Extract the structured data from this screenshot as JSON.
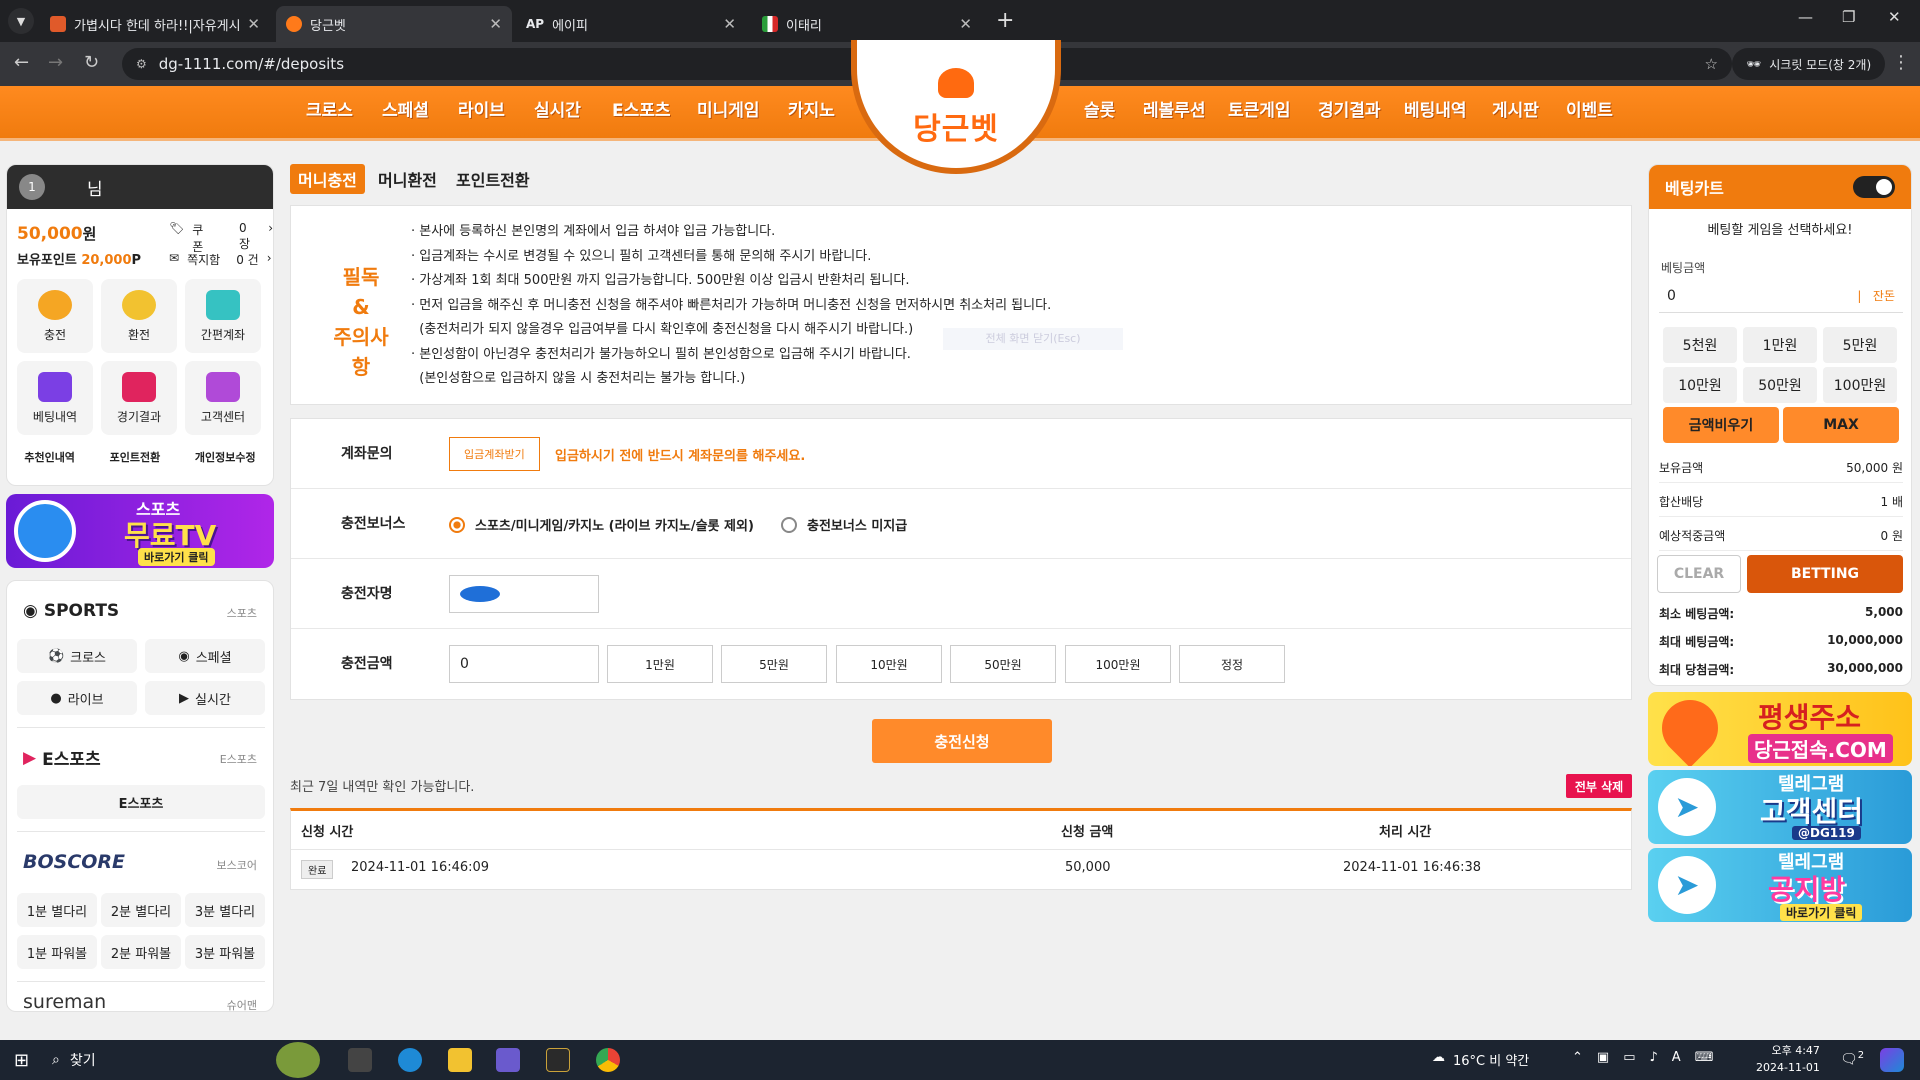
{
  "browser": {
    "tabs": [
      {
        "title": "가볍시다 한데 하라!!|자유게시판",
        "active": false
      },
      {
        "title": "당근벳",
        "active": true
      },
      {
        "title": "에이피",
        "prefix": "AP",
        "active": false
      },
      {
        "title": "이태리",
        "active": false
      }
    ],
    "url": "dg-1111.com/#/deposits",
    "incognito_label": "시크릿 모드(창 2개)"
  },
  "nav": {
    "left": [
      "크로스",
      "스페셜",
      "라이브",
      "실시간",
      "E스포츠",
      "미니게임",
      "카지노"
    ],
    "right": [
      "슬롯",
      "레볼루션",
      "토큰게임",
      "경기결과",
      "베팅내역",
      "게시판",
      "이벤트"
    ],
    "logo": "당근벳"
  },
  "user": {
    "level": "1",
    "name": "님",
    "balance": "50,000",
    "balance_unit": "원",
    "points_label": "보유포인트",
    "points": "20,000",
    "points_unit": "P",
    "coupon_label": "쿠폰",
    "coupon_count": "0 장",
    "note_label": "쪽지함",
    "note_count": "0 건",
    "quick": [
      "충전",
      "환전",
      "간편계좌",
      "베팅내역",
      "경기결과",
      "고객센터"
    ],
    "links": [
      "추천인내역",
      "포인트전환",
      "개인정보수정"
    ]
  },
  "promo_tv": {
    "line1": "스포츠",
    "line2": "무료TV",
    "line3": "바로가기 클릭"
  },
  "sports": {
    "title": "SPORTS",
    "sub": "스포츠",
    "items": [
      "크로스",
      "스페셜",
      "라이브",
      "실시간"
    ],
    "esports_title": "E스포츠",
    "esports_sub": "E스포츠",
    "esports_item": "E스포츠",
    "boscore_title": "BOSCORE",
    "boscore_sub": "보스코어",
    "boscore_items": [
      "1분 별다리",
      "2분 별다리",
      "3분 별다리",
      "1분 파워볼",
      "2분 파워볼",
      "3분 파워볼"
    ],
    "sureman_title": "sureman",
    "sureman_sub": "슈어맨"
  },
  "main": {
    "tabs": [
      "머니충전",
      "머니환전",
      "포인트전환"
    ],
    "notice_title": [
      "필독",
      "&",
      "주의사항"
    ],
    "notice_lines": [
      "· 본사에 등록하신 본인명의 계좌에서 입금 하셔야 입금 가능합니다.",
      "· 입금계좌는 수시로 변경될 수 있으니 필히 고객센터를 통해 문의해 주시기 바랍니다.",
      "· 가상계좌 1회 최대 500만원 까지 입금가능합니다. 500만원 이상 입금시 반환처리 됩니다.",
      "· 먼저 입금을 해주신 후 머니충전 신청을 해주셔야 빠른처리가 가능하며 머니충전 신청을 먼저하시면 취소처리 됩니다.",
      "  (충전처리가 되지 않을경우 입금여부를 다시 확인후에 충전신청을 다시 해주시기 바랍니다.)",
      "· 본인성함이 아닌경우 충전처리가 불가능하오니 필히 본인성함으로 입금해 주시기 바랍니다.",
      "  (본인성함으로 입금하지 않을 시 충전처리는 불가능 합니다.)"
    ],
    "notice_ghost": "전체 화면 닫기(Esc)",
    "form": {
      "account_label": "계좌문의",
      "account_button": "입금계좌받기",
      "account_hint": "입금하시기 전에 반드시 계좌문의를 해주세요.",
      "bonus_label": "충전보너스",
      "bonus_opt1": "스포츠/미니게임/카지노 (라이브 카지노/슬롯 제외)",
      "bonus_opt2": "충전보너스 미지급",
      "name_label": "충전자명",
      "amount_label": "충전금액",
      "amount_value": "0",
      "amount_buttons": [
        "1만원",
        "5만원",
        "10만원",
        "50만원",
        "100만원",
        "정정"
      ]
    },
    "submit": "충전신청",
    "history_info": "최근 7일 내역만 확인 가능합니다.",
    "delete_all": "전부 삭제",
    "history_headers": [
      "신청 시간",
      "신청 금액",
      "처리 시간"
    ],
    "history_rows": [
      {
        "status": "완료",
        "requested": "2024-11-01 16:46:09",
        "amount": "50,000",
        "processed": "2024-11-01 16:46:38"
      }
    ]
  },
  "cart": {
    "title": "베팅카트",
    "select_msg": "베팅할 게임을 선택하세요!",
    "amount_label": "베팅금액",
    "amount_value": "0",
    "remain_label": "잔돈",
    "quick": [
      "5천원",
      "1만원",
      "5만원",
      "10만원",
      "50만원",
      "100만원"
    ],
    "empty_btn": "금액비우기",
    "max_btn": "MAX",
    "hold_label": "보유금액",
    "hold_value": "50,000 원",
    "odds_label": "합산배당",
    "odds_value": "1 배",
    "expect_label": "예상적중금액",
    "expect_value": "0 원",
    "clear_btn": "CLEAR",
    "bet_btn": "BETTING",
    "min_label": "최소 베팅금액:",
    "min_value": "5,000",
    "max_label": "최대 베팅금액:",
    "max_value": "10,000,000",
    "win_label": "최대 당첨금액:",
    "win_value": "30,000,000"
  },
  "banners": [
    {
      "line1": "평생주소",
      "line2": "당근접속.COM"
    },
    {
      "line1": "텔레그램",
      "line2": "고객센터",
      "line3": "@DG119"
    },
    {
      "line1": "텔레그램",
      "line2": "공지방",
      "line3": "바로가기 클릭"
    }
  ],
  "taskbar": {
    "search": "찾기",
    "weather": "16°C  비 약간",
    "time": "오후 4:47",
    "date": "2024-11-01",
    "notify_count": "2"
  },
  "colors": {
    "accent": "#f07b0e",
    "danger": "#e8134e",
    "dark": "#2d2d2d"
  }
}
